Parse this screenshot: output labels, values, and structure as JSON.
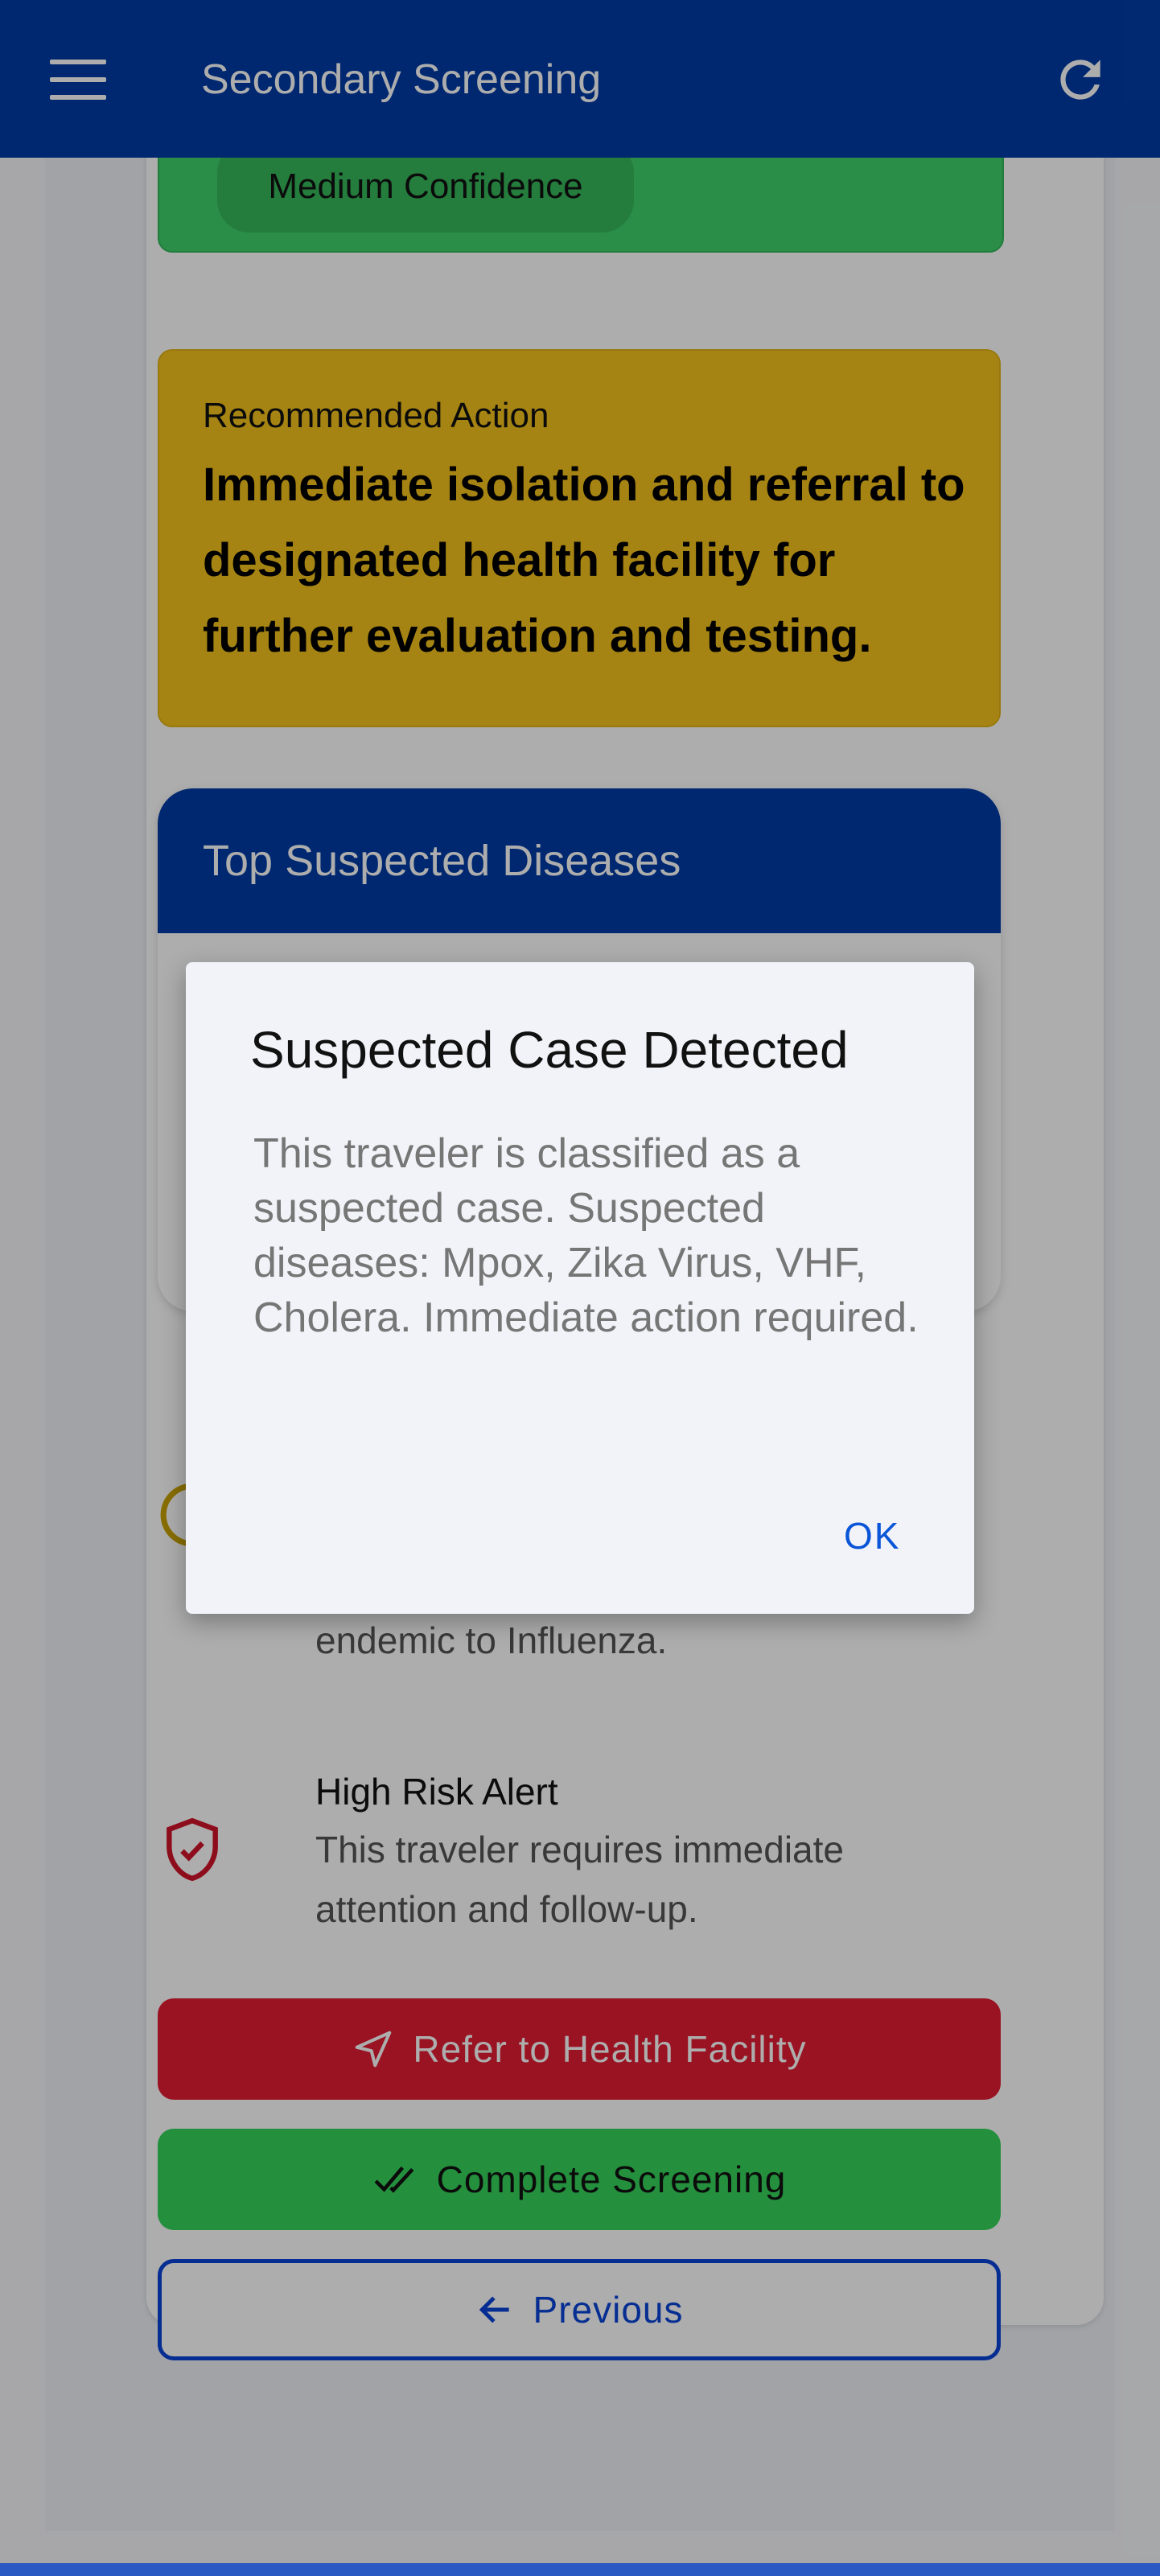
{
  "appbar": {
    "title": "Secondary Screening",
    "menu_icon": "menu-icon",
    "refresh_icon": "refresh-icon",
    "background": "#003ca6"
  },
  "diagnosis": {
    "confidence": "Medium Confidence",
    "color": "#3fd16c"
  },
  "recommended_action": {
    "label": "Recommended Action",
    "text": "Immediate isolation and referral to designated health facility for further evaluation and testing.",
    "color": "#f5c31c"
  },
  "diseases": {
    "header": "Top Suspected Diseases"
  },
  "alerts": [
    {
      "icon": "warning-icon",
      "description_partial": "endemic to Influenza."
    },
    {
      "icon": "shield-check-icon",
      "title": "High Risk Alert",
      "description": "This traveler requires immediate attention and follow-up."
    }
  ],
  "buttons": {
    "refer": "Refer to Health Facility",
    "complete": "Complete Screening",
    "previous": "Previous"
  },
  "dialog": {
    "title": "Suspected Case Detected",
    "message": "This traveler is classified as a suspected case. Suspected diseases: Mpox, Zika Virus, VHF, Cholera. Immediate action required.",
    "ok": "OK"
  }
}
